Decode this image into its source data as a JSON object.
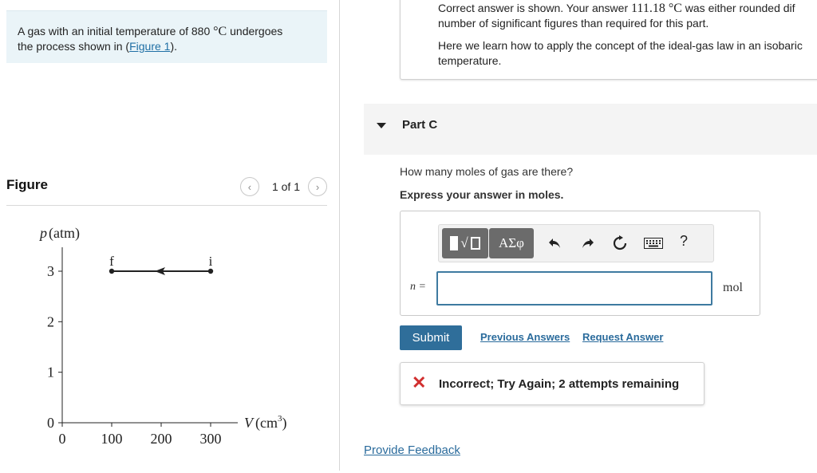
{
  "problem": {
    "text_before": "A gas with an initial temperature of 880 ",
    "temp_unit": "°C",
    "text_after": " undergoes",
    "line2_before": "the process shown in (",
    "figure_link": "Figure 1",
    "line2_after": ")."
  },
  "figure": {
    "title": "Figure",
    "page_indicator": "1 of 1",
    "prev_icon": "chevron-left-icon",
    "next_icon": "chevron-right-icon"
  },
  "feedback": {
    "line1_before": "Correct answer is shown. Your answer ",
    "line1_math": "111.18 °C",
    "line1_after": " was either rounded dif",
    "line1b": "number of significant figures than required for this part.",
    "line2": "Here we learn how to apply the concept of the ideal-gas law in an isobaric",
    "line2b": "temperature."
  },
  "part": {
    "label": "Part C",
    "question": "How many moles of gas are there?",
    "instruction": "Express your answer in moles."
  },
  "toolbar": {
    "greek_label": "ΑΣφ",
    "undo_icon": "undo-icon",
    "redo_icon": "redo-icon",
    "reset_icon": "reset-icon",
    "keyboard_icon": "keyboard-icon",
    "help_label": "?"
  },
  "answer": {
    "variable_label": "n =",
    "value": "",
    "unit": "mol"
  },
  "actions": {
    "submit": "Submit",
    "previous_answers": "Previous Answers",
    "request_answer": "Request Answer"
  },
  "result": {
    "icon": "x-icon",
    "text": "Incorrect; Try Again; 2 attempts remaining",
    "color": "#d12f2f"
  },
  "footer": {
    "provide_feedback": "Provide Feedback"
  },
  "chart_data": {
    "type": "line",
    "ylabel": "p (atm)",
    "xlabel_main": "V (cm",
    "xlabel_sup": "3",
    "xlabel_close": ")",
    "x_ticks": [
      0,
      100,
      200,
      300
    ],
    "y_ticks": [
      0,
      1,
      2,
      3
    ],
    "xlim": [
      0,
      300
    ],
    "ylim": [
      0,
      3
    ],
    "points": [
      {
        "label": "f",
        "x": 100,
        "y": 3
      },
      {
        "label": "i",
        "x": 300,
        "y": 3
      }
    ],
    "direction": "from i to f"
  }
}
